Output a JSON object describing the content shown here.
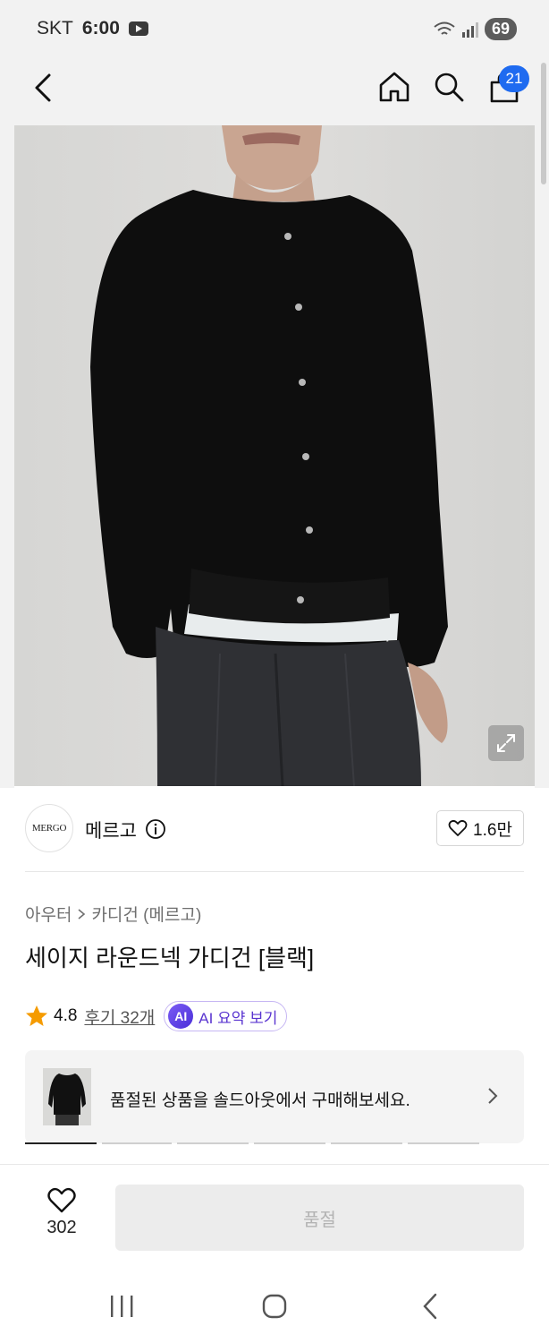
{
  "status_bar": {
    "carrier": "SKT",
    "time": "6:00",
    "battery": "69",
    "icons": [
      "youtube-icon",
      "wifi-icon",
      "signal-icon",
      "battery-icon"
    ]
  },
  "app_bar": {
    "icons": [
      "back-arrow-icon",
      "home-icon",
      "search-icon",
      "cart-icon"
    ],
    "cart_count": "21"
  },
  "brand": {
    "logo_text": "MERGO",
    "name": "메르고",
    "likes": "1.6만"
  },
  "breadcrumb": {
    "category": "아우터",
    "subcategory": "카디건 (메르고)"
  },
  "product": {
    "title": "세이지 라운드넥 가디건 [블랙]",
    "rating": "4.8",
    "reviews": "후기 32개",
    "ai_badge": "AI",
    "ai_summary_label": "AI 요약 보기"
  },
  "soldout_banner": {
    "text": "품절된 상품을 솔드아웃에서 구매해보세요."
  },
  "bottom_bar": {
    "wish_count": "302",
    "buy_label": "품절"
  },
  "nav_bar": {
    "icons": [
      "recent-apps-icon",
      "home-circle-icon",
      "back-icon"
    ]
  },
  "colors": {
    "accent": "#1f6bf0",
    "ai_purple": "#5a35d0",
    "star": "#f59b00",
    "disabled_text": "#b3b3b3"
  }
}
